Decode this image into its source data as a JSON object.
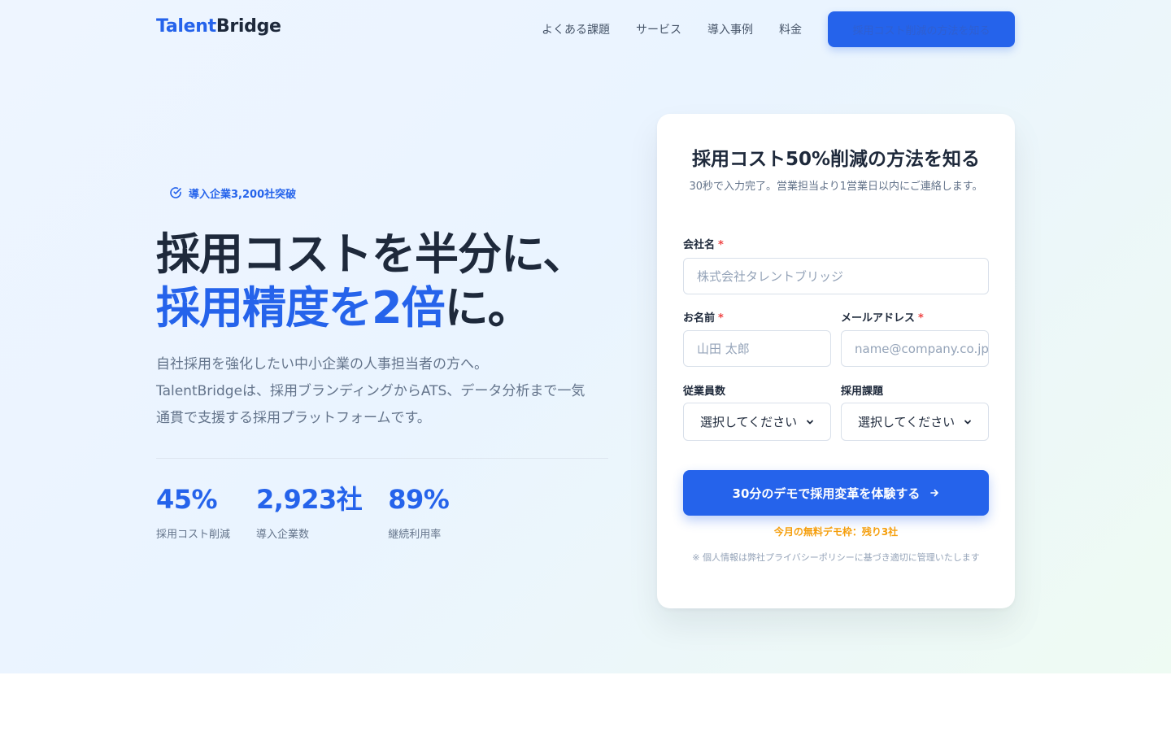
{
  "header": {
    "logo_part1": "Talent",
    "logo_part2": "Bridge",
    "nav": [
      "よくある課題",
      "サービス",
      "導入事例",
      "料金"
    ],
    "cta_label": "採用コスト削減の方法を知る"
  },
  "hero": {
    "badge": "導入企業3,200社突破",
    "headline_line1": "採用コストを半分に、",
    "headline_line2_blue": "採用精度を2倍",
    "headline_line2_rest": "に。",
    "lead_lines": [
      "自社採用を強化したい中小企業の人事担当者の方へ。",
      "TalentBridgeは、採用ブランディングからATS、データ分析まで一気",
      "通貫で支援する採用プラットフォームです。"
    ],
    "stats": [
      {
        "value": "45%",
        "label": "採用コスト削減"
      },
      {
        "value": "2,923社",
        "label": "導入企業数"
      },
      {
        "value": "89%",
        "label": "継続利用率"
      }
    ]
  },
  "form": {
    "title": "採用コスト50%削減の方法を知る",
    "subtitle": "30秒で入力完了。営業担当より1営業日以内にご連絡します。",
    "company_label": "会社名",
    "company_placeholder": "株式会社タレントブリッジ",
    "name_label": "お名前",
    "name_placeholder": "山田 太郎",
    "email_label": "メールアドレス",
    "email_placeholder": "name@company.co.jp",
    "employees_label": "従業員数",
    "employees_value": "選択してください",
    "issue_label": "採用課題",
    "issue_value": "選択してください",
    "required_mark": "*",
    "submit_label": "30分のデモで採用変革を体験する",
    "urgency": "今月の無料デモ枠：残り3社",
    "privacy": "※ 個人情報は弊社プライバシーポリシーに基づき適切に管理いたします"
  },
  "colors": {
    "accent": "#2563eb",
    "text": "#1e293b",
    "muted": "#64748b",
    "required": "#ef4444",
    "urgency": "#f59e0b"
  },
  "icons": {
    "badge": "check-circle-icon",
    "submit": "arrow-right-icon",
    "select": "chevron-down-icon"
  }
}
